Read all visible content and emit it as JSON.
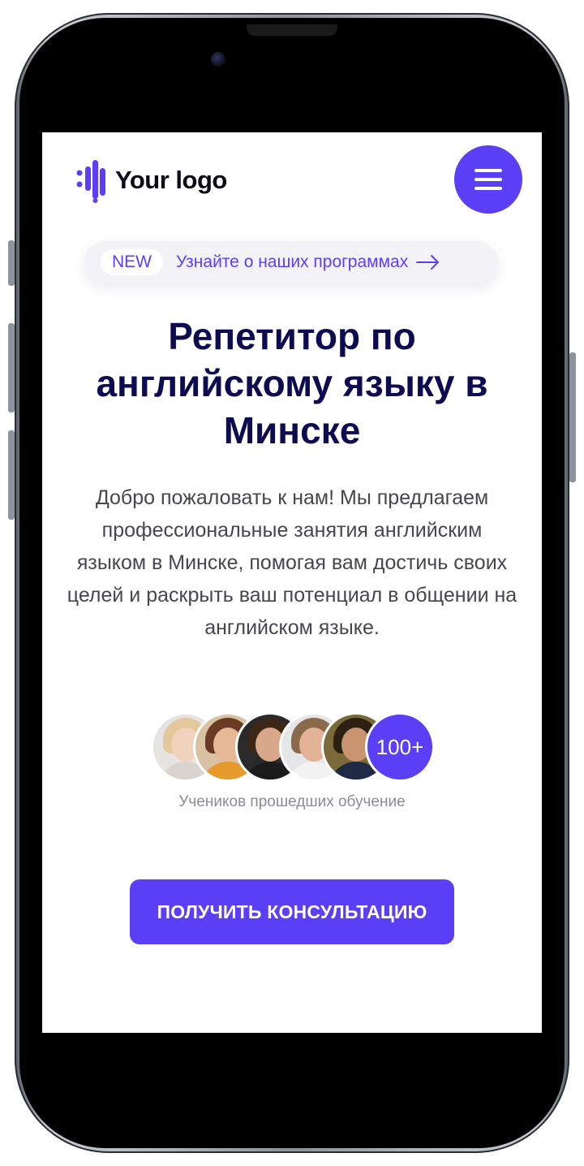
{
  "header": {
    "logo_text": "Your logo",
    "menu_icon": "hamburger-menu-icon"
  },
  "promo": {
    "badge": "NEW",
    "text": "Узнайте о наших программах",
    "icon": "arrow-right-icon"
  },
  "hero": {
    "title": "Репетитор по английскому языку в Минске",
    "description": "Добро пожаловать к нам! Мы предлагаем профессиональные занятия английским языком в Минске, помогая вам достичь своих целей и раскрыть ваш потенциал в общении на английском языке."
  },
  "students": {
    "count": "100+",
    "caption": "Учеников прошедших обучение"
  },
  "cta": {
    "label": "ПОЛУЧИТЬ КОНСУЛЬТАЦИЮ"
  },
  "colors": {
    "accent": "#5b3ff6",
    "title": "#0d0b52",
    "body_text": "#46464f",
    "caption": "#8b8b95"
  }
}
